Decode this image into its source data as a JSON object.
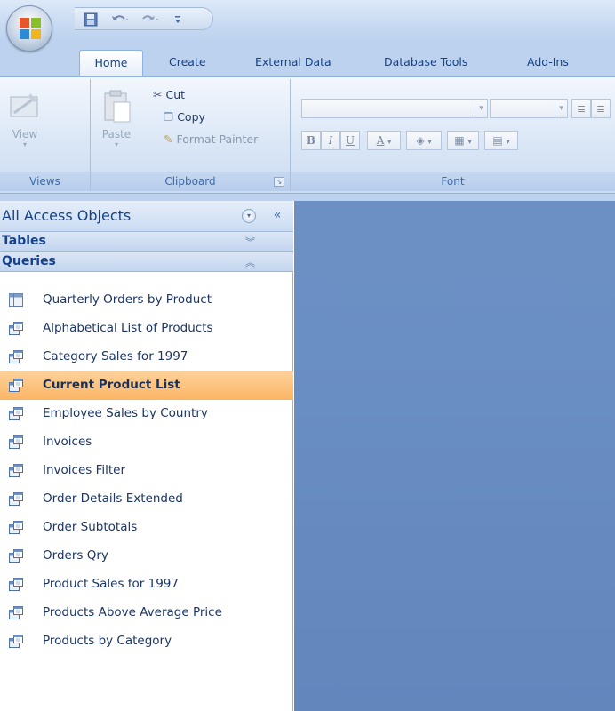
{
  "app": {
    "colors": {
      "accent": "#15428b",
      "ribbon_bg": "#dbe7f6",
      "selected": "#fbb565",
      "workspace": "#6a8fc4"
    }
  },
  "quick_access": {
    "icons": [
      "save-icon",
      "undo-icon",
      "redo-icon",
      "customize-icon"
    ]
  },
  "tabs": [
    {
      "label": "Home",
      "active": true
    },
    {
      "label": "Create",
      "active": false
    },
    {
      "label": "External Data",
      "active": false
    },
    {
      "label": "Database Tools",
      "active": false
    },
    {
      "label": "Add-Ins",
      "active": false
    }
  ],
  "ribbon": {
    "views": {
      "view_label": "View",
      "group_label": "Views"
    },
    "clipboard": {
      "paste_label": "Paste",
      "cut_label": "Cut",
      "copy_label": "Copy",
      "format_painter_label": "Format Painter",
      "group_label": "Clipboard"
    },
    "font": {
      "group_label": "Font",
      "bold": "B",
      "italic": "I",
      "underline": "U",
      "font_color": "A"
    }
  },
  "nav": {
    "title": "All Access Objects",
    "groups": [
      {
        "label": "Tables",
        "expanded": false
      },
      {
        "label": "Queries",
        "expanded": true
      }
    ],
    "items": [
      {
        "label": "Quarterly Orders by Product",
        "icon": "crosstab-query-icon",
        "selected": false
      },
      {
        "label": "Alphabetical List of Products",
        "icon": "select-query-icon",
        "selected": false
      },
      {
        "label": "Category Sales for 1997",
        "icon": "select-query-icon",
        "selected": false
      },
      {
        "label": "Current Product List",
        "icon": "select-query-icon",
        "selected": true
      },
      {
        "label": "Employee Sales by Country",
        "icon": "select-query-icon",
        "selected": false
      },
      {
        "label": "Invoices",
        "icon": "select-query-icon",
        "selected": false
      },
      {
        "label": "Invoices Filter",
        "icon": "select-query-icon",
        "selected": false
      },
      {
        "label": "Order Details Extended",
        "icon": "select-query-icon",
        "selected": false
      },
      {
        "label": "Order Subtotals",
        "icon": "select-query-icon",
        "selected": false
      },
      {
        "label": "Orders Qry",
        "icon": "select-query-icon",
        "selected": false
      },
      {
        "label": "Product Sales for 1997",
        "icon": "select-query-icon",
        "selected": false
      },
      {
        "label": "Products Above Average Price",
        "icon": "select-query-icon",
        "selected": false
      },
      {
        "label": "Products by Category",
        "icon": "select-query-icon",
        "selected": false
      }
    ]
  }
}
